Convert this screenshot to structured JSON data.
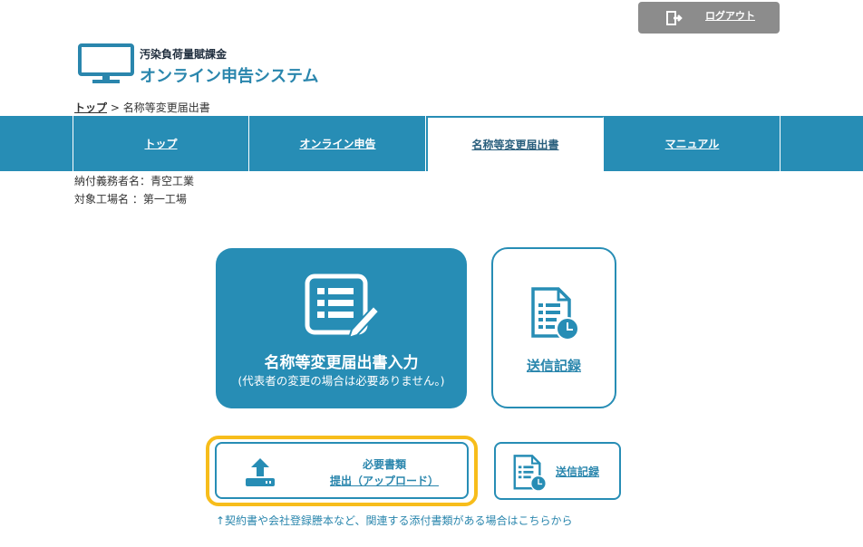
{
  "header": {
    "logout_label": "ログアウト",
    "logo_line1": "汚染負荷量賦課金",
    "logo_line2": "オンライン申告システム"
  },
  "breadcrumb": {
    "home": "トップ",
    "separator": ">",
    "current": "名称等変更届出書"
  },
  "nav": {
    "tabs": [
      {
        "label": "トップ"
      },
      {
        "label": "オンライン申告"
      },
      {
        "label": "名称等変更届出書",
        "active": true
      },
      {
        "label": "マニュアル"
      }
    ]
  },
  "info": {
    "payer": "納付義務者名：青空工業",
    "factory": "対象工場名 ：第一工場"
  },
  "cards": {
    "main_title": "名称等変更届出書入力",
    "main_subtitle": "(代表者の変更の場合は必要ありません。)",
    "history_label": "送信記録",
    "upload_line1": "必要書類",
    "upload_line2": "提出（アップロード）",
    "history_small_label": "送信記録"
  },
  "note": "↑契約書や会社登録謄本など、関連する添付書類がある場合はこちらから",
  "colors": {
    "primary": "#278db5",
    "highlight": "#f7bd1b",
    "logout_bg": "#8c8c8c"
  },
  "icons": [
    "logout-icon",
    "monitor-icon",
    "form-edit-icon",
    "document-clock-icon",
    "upload-icon"
  ]
}
